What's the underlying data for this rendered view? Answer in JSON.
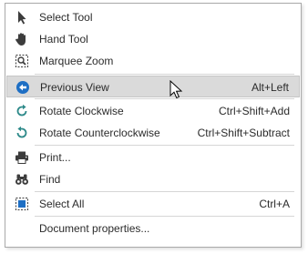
{
  "menu": {
    "items": [
      {
        "label": "Select Tool",
        "shortcut": "",
        "icon": "arrow-pointer-icon"
      },
      {
        "label": "Hand Tool",
        "shortcut": "",
        "icon": "hand-icon"
      },
      {
        "label": "Marquee Zoom",
        "shortcut": "",
        "icon": "marquee-zoom-icon"
      },
      {
        "label": "Previous View",
        "shortcut": "Alt+Left",
        "icon": "previous-view-icon"
      },
      {
        "label": "Rotate Clockwise",
        "shortcut": "Ctrl+Shift+Add",
        "icon": "rotate-clockwise-icon"
      },
      {
        "label": "Rotate Counterclockwise",
        "shortcut": "Ctrl+Shift+Subtract",
        "icon": "rotate-counterclockwise-icon"
      },
      {
        "label": "Print...",
        "shortcut": "",
        "icon": "printer-icon"
      },
      {
        "label": "Find",
        "shortcut": "",
        "icon": "binoculars-icon"
      },
      {
        "label": "Select All",
        "shortcut": "Ctrl+A",
        "icon": "select-all-icon"
      },
      {
        "label": "Document properties...",
        "shortcut": "",
        "icon": ""
      }
    ],
    "highlighted_item": "Previous View",
    "colors": {
      "highlight": "#dadada",
      "icon_blue": "#1e6fc4",
      "icon_teal": "#2e8a8a",
      "icon_dark": "#3c3c3c"
    }
  }
}
